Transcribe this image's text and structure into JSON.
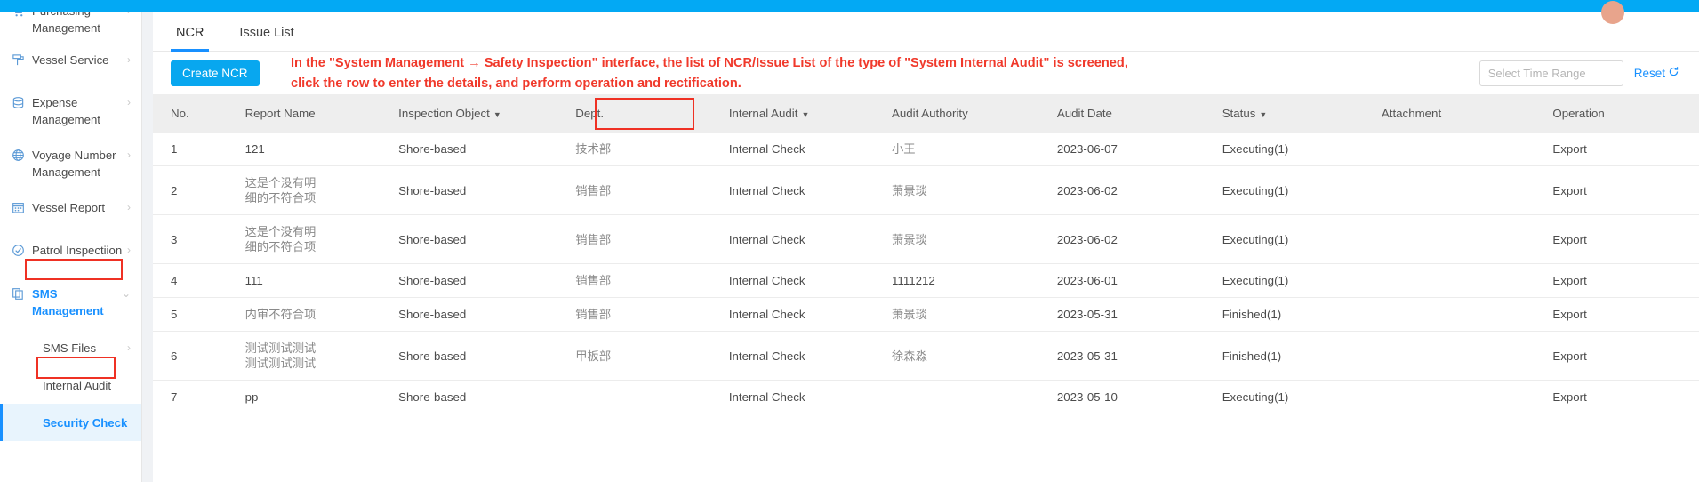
{
  "topbar": {
    "avatar_label": "user-avatar"
  },
  "sidebar": {
    "items": [
      {
        "label": "Purchasing\nManagement",
        "icon": "cart-icon",
        "chevron": "›",
        "type": "group",
        "highlight": false
      },
      {
        "label": "Vessel Service",
        "icon": "paint-roller-icon",
        "chevron": "›",
        "type": "group",
        "highlight": false
      },
      {
        "label": "Expense Management",
        "icon": "database-icon",
        "chevron": "›",
        "type": "group",
        "highlight": false
      },
      {
        "label": "Voyage Number\nManagement",
        "icon": "globe-icon",
        "chevron": "›",
        "type": "group",
        "highlight": false
      },
      {
        "label": "Vessel Report",
        "icon": "calendar-icon",
        "chevron": "›",
        "type": "group",
        "highlight": false
      },
      {
        "label": "Patrol Inspectiion",
        "icon": "check-circle-icon",
        "chevron": "›",
        "type": "group",
        "highlight": false
      },
      {
        "label": "SMS Management",
        "icon": "documents-icon",
        "chevron": "⌄",
        "type": "group",
        "highlight": true
      }
    ],
    "subitems": [
      {
        "label": "SMS Files",
        "chevron": "›",
        "active": false,
        "highlight": false
      },
      {
        "label": "Internal Audit",
        "chevron": "",
        "active": false,
        "highlight": false
      },
      {
        "label": "Security Check",
        "chevron": "",
        "active": true,
        "highlight": true
      }
    ]
  },
  "tabs": [
    {
      "label": "NCR",
      "active": true
    },
    {
      "label": "Issue List",
      "active": false
    }
  ],
  "toolbar": {
    "create_label": "Create NCR",
    "time_placeholder": "Select Time Range",
    "time_value": "",
    "reset_label": "Reset",
    "reset_icon": "refresh-icon"
  },
  "annotation": {
    "line1": "In the \"System Management → Safety Inspection\" interface, the list of NCR/Issue List of the type of \"System Internal Audit\" is screened,",
    "line2": "click the row to enter the details, and perform operation and rectification."
  },
  "table": {
    "columns": [
      {
        "label": "No.",
        "sortable": false,
        "highlighted": false
      },
      {
        "label": "Report Name",
        "sortable": false,
        "highlighted": false
      },
      {
        "label": "Inspection Object",
        "sortable": true,
        "highlighted": false
      },
      {
        "label": "Dept.",
        "sortable": false,
        "highlighted": false
      },
      {
        "label": "Internal Audit",
        "sortable": true,
        "highlighted": true
      },
      {
        "label": "Audit Authority",
        "sortable": false,
        "highlighted": false
      },
      {
        "label": "Audit Date",
        "sortable": false,
        "highlighted": false
      },
      {
        "label": "Status",
        "sortable": true,
        "highlighted": false
      },
      {
        "label": "Attachment",
        "sortable": false,
        "highlighted": false
      },
      {
        "label": "Operation",
        "sortable": false,
        "highlighted": false
      }
    ],
    "caret_glyph": "▼",
    "rows": [
      {
        "no": "1",
        "report_name": "121",
        "inspection_object": "Shore-based",
        "dept": "技术部",
        "internal_audit": "Internal Check",
        "audit_authority": "小王",
        "audit_date": "2023-06-07",
        "status": "Executing(1)",
        "attachment": "",
        "operation": "Export"
      },
      {
        "no": "2",
        "report_name": "这是个没有明\n细的不符合项",
        "inspection_object": "Shore-based",
        "dept": "销售部",
        "internal_audit": "Internal Check",
        "audit_authority": "萧景琰",
        "audit_date": "2023-06-02",
        "status": "Executing(1)",
        "attachment": "",
        "operation": "Export"
      },
      {
        "no": "3",
        "report_name": "这是个没有明\n细的不符合项",
        "inspection_object": "Shore-based",
        "dept": "销售部",
        "internal_audit": "Internal Check",
        "audit_authority": "萧景琰",
        "audit_date": "2023-06-02",
        "status": "Executing(1)",
        "attachment": "",
        "operation": "Export"
      },
      {
        "no": "4",
        "report_name": "111",
        "inspection_object": "Shore-based",
        "dept": "销售部",
        "internal_audit": "Internal Check",
        "audit_authority": "1111212",
        "audit_date": "2023-06-01",
        "status": "Executing(1)",
        "attachment": "",
        "operation": "Export"
      },
      {
        "no": "5",
        "report_name": "内审不符合项",
        "inspection_object": "Shore-based",
        "dept": "销售部",
        "internal_audit": "Internal Check",
        "audit_authority": "萧景琰",
        "audit_date": "2023-05-31",
        "status": "Finished(1)",
        "attachment": "",
        "operation": "Export"
      },
      {
        "no": "6",
        "report_name": "测试测试测试\n测试测试测试",
        "inspection_object": "Shore-based",
        "dept": "甲板部",
        "internal_audit": "Internal Check",
        "audit_authority": "徐森淼",
        "audit_date": "2023-05-31",
        "status": "Finished(1)",
        "attachment": "",
        "operation": "Export"
      },
      {
        "no": "7",
        "report_name": "pp",
        "inspection_object": "Shore-based",
        "dept": "",
        "internal_audit": "Internal Check",
        "audit_authority": "",
        "audit_date": "2023-05-10",
        "status": "Executing(1)",
        "attachment": "",
        "operation": "Export"
      }
    ]
  },
  "colors": {
    "accent": "#1890ff",
    "topbar": "#03a9f4",
    "annotation": "#f0392b",
    "highlight_box": "#ef3124",
    "button": "#08a7ef"
  }
}
